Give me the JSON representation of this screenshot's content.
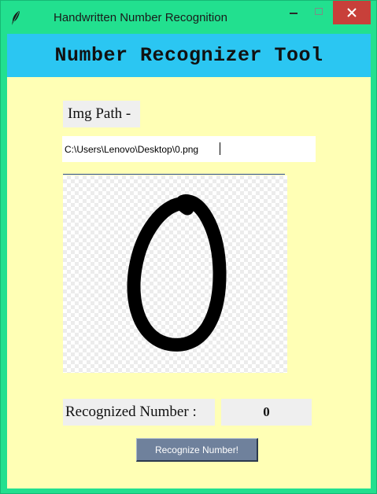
{
  "window": {
    "title": "Handwritten Number Recognition",
    "icon": "feather-icon",
    "controls": [
      "minimize-icon",
      "maximize-icon",
      "close-icon"
    ]
  },
  "header": {
    "title": "Number Recognizer Tool"
  },
  "form": {
    "img_path_label": "Img Path -",
    "img_path_value": "C:\\Users\\Lenovo\\Desktop\\0.png"
  },
  "result": {
    "label": "Recognized Number :",
    "value": "0"
  },
  "actions": {
    "recognize_label": "Recognize Number!"
  },
  "colors": {
    "window_frame": "#22e08f",
    "header_band": "#2bc6f2",
    "content_bg": "#ffffb5",
    "button_bg": "#6f819c",
    "close_button": "#c8403a"
  }
}
